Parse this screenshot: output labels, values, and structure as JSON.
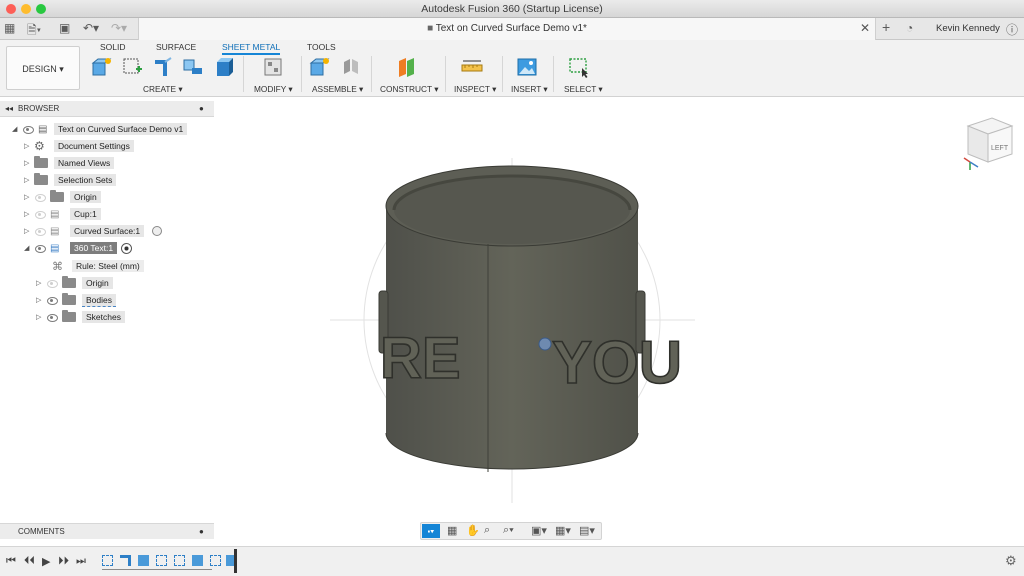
{
  "window": {
    "title": "Autodesk Fusion 360 (Startup License)"
  },
  "tab": {
    "title": "Text on Curved Surface Demo v1*"
  },
  "user": {
    "name": "Kevin Kennedy"
  },
  "toolbar": {
    "workspace_button": "DESIGN ▾",
    "workspace_tabs": [
      "SOLID",
      "SURFACE",
      "SHEET METAL",
      "TOOLS"
    ],
    "active_tab": "SHEET METAL",
    "groups": [
      "CREATE ▾",
      "MODIFY ▾",
      "ASSEMBLE ▾",
      "CONSTRUCT ▾",
      "INSPECT ▾",
      "INSERT ▾",
      "SELECT ▾"
    ]
  },
  "browser": {
    "header": "BROWSER",
    "root": "Text on Curved Surface Demo v1",
    "items": [
      {
        "label": "Document Settings"
      },
      {
        "label": "Named Views"
      },
      {
        "label": "Selection Sets"
      },
      {
        "label": "Origin"
      },
      {
        "label": "Cup:1"
      },
      {
        "label": "Curved Surface:1"
      },
      {
        "label": "360 Text:1"
      },
      {
        "label": "Rule: Steel (mm)"
      },
      {
        "label": "Origin"
      },
      {
        "label": "Bodies"
      },
      {
        "label": "Sketches"
      }
    ]
  },
  "viewport": {
    "viewcube_label": "LEFT",
    "model_text_left": "RE",
    "model_text_right": "YOU"
  },
  "comments": {
    "header": "COMMENTS"
  },
  "colors": {
    "accent": "#1585d6",
    "model": "#5c5d56"
  }
}
